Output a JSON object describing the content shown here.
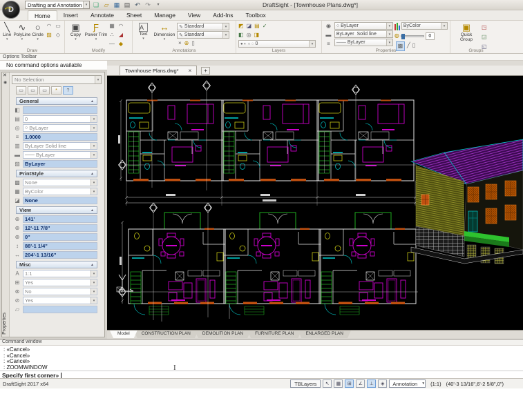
{
  "window": {
    "title": "DraftSight - [Townhouse Plans.dwg*]",
    "workspace": "Drafting and Annotation"
  },
  "menu": {
    "tabs": [
      "Home",
      "Insert",
      "Annotate",
      "Sheet",
      "Manage",
      "View",
      "Add-Ins",
      "Toolbox"
    ],
    "active": "Home"
  },
  "ribbon": {
    "draw": {
      "label": "Draw",
      "line": "Line",
      "polyline": "PolyLine",
      "circle": "Circle"
    },
    "modify": {
      "label": "Modify",
      "copy": "Copy",
      "power_trim": "Power Trim"
    },
    "annotations": {
      "label": "Annotations",
      "text": "Text",
      "dimension": "Dimension",
      "text_style": "Standard",
      "dim_style": "Standard"
    },
    "layers": {
      "label": "Layers",
      "current_layer": "0"
    },
    "properties": {
      "label": "Properties",
      "line_color": "ByLayer",
      "line_style_a": "ByLayer",
      "line_style_b": "Solid line",
      "line_weight": "ByLayer",
      "color": "ByColor",
      "transparency_value": "0"
    },
    "groups": {
      "label": "Groups",
      "quick_group": "Quick Group"
    }
  },
  "options_bar": {
    "title": "Options Toolbar",
    "message": "No command options available"
  },
  "palette": {
    "tab_label": "Properties",
    "selection": "No Selection",
    "sections": [
      {
        "title": "General",
        "rows": [
          {
            "icon": "color",
            "value": ""
          },
          {
            "icon": "layer",
            "value": "0"
          },
          {
            "icon": "line-color",
            "value": "ByLayer"
          },
          {
            "icon": "linetype-scale",
            "value": "1.0000"
          },
          {
            "icon": "line-style",
            "value": "ByLayer   Solid line"
          },
          {
            "icon": "line-weight",
            "value": "ByLayer"
          },
          {
            "icon": "transparency",
            "value": "ByLayer"
          }
        ]
      },
      {
        "title": "PrintStyle",
        "rows": [
          {
            "icon": "print-style",
            "value": "None"
          },
          {
            "icon": "print-color",
            "value": "ByColor"
          },
          {
            "icon": "print-table",
            "value": "None"
          }
        ]
      },
      {
        "title": "View",
        "rows": [
          {
            "icon": "center-x",
            "value": "141'"
          },
          {
            "icon": "center-y",
            "value": "12'-11 7/8\""
          },
          {
            "icon": "center-z",
            "value": "0\""
          },
          {
            "icon": "height",
            "value": "88'-1 1/4\""
          },
          {
            "icon": "width",
            "value": "204'-1 13/16\""
          }
        ]
      },
      {
        "title": "Misc",
        "rows": [
          {
            "icon": "annotation-scale",
            "value": "1:1"
          },
          {
            "icon": "ucs-icon",
            "value": "Yes"
          },
          {
            "icon": "ucs-origin",
            "value": "No"
          },
          {
            "icon": "ucs-viewport",
            "value": "Yes"
          },
          {
            "icon": "visual-style",
            "value": ""
          }
        ]
      }
    ]
  },
  "document": {
    "tab": "Townhouse Plans.dwg*",
    "close": "×",
    "new_tab": "+"
  },
  "sheets": {
    "active": "Model",
    "tabs": [
      "Model",
      "CONSTRUCTION PLAN",
      "DEMOLITION PLAN",
      "FURNITURE PLAN",
      "ENLARGED PLAN"
    ]
  },
  "command": {
    "title": "Command window",
    "lines": [
      ": «Cancel»",
      ": «Cancel»",
      ": «Cancel»",
      ": ZOOMWINDOW"
    ],
    "prompt": "Specify first corner»"
  },
  "status": {
    "version": "DraftSight 2017 x64",
    "tblayers": "TBLayers",
    "annotation": "Annotation",
    "scale": "(1:1)",
    "coords": "(40'-3 13/16\",6'-2 5/8\",0\")"
  },
  "drawing_colors": {
    "walls": "#e8e8e8",
    "furniture": "#cc00cc",
    "doors_fixtures": "#00b8b8",
    "stairs": "#1fae1f",
    "sills": "#c05010",
    "bath": "#c8c814",
    "roof": "#3d0a52",
    "gable_wall": "#4f4f10",
    "windows": "#b35100",
    "porch": "#2ec22e"
  }
}
